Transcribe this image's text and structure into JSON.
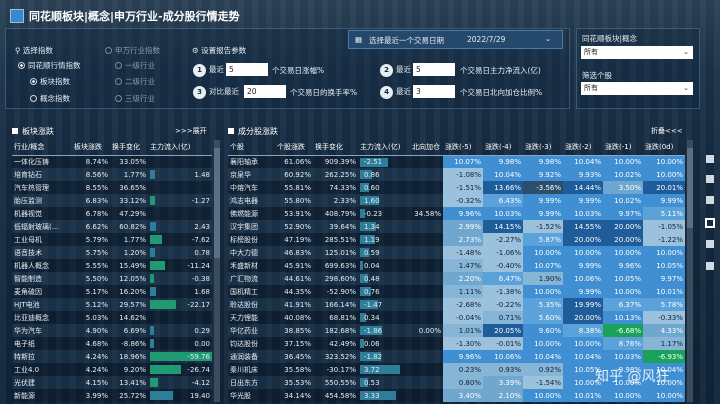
{
  "header": {
    "title": "同花顺板块|概念|申万行业-成分股行情走势"
  },
  "filters": {
    "select_index_label": "选择指数",
    "sw_industry_label": "申万行业指数",
    "ths_index_label": "同花顺行情指数",
    "sector_index": "板块指数",
    "concept_index": "概念指数",
    "level1": "一级行业",
    "level2": "二级行业",
    "level3": "三级行业",
    "settings_label": "设置报告参数",
    "p1_prefix": "最近",
    "p1_value": "5",
    "p1_suffix": "个交易日涨幅%",
    "p2_prefix": "最近",
    "p2_value": "5",
    "p2_suffix": "个交易日主力净流入(亿)",
    "p3_prefix": "对比最近",
    "p3_value": "20",
    "p3_suffix": "个交易日的换手率%",
    "p4_prefix": "最近",
    "p4_value": "3",
    "p4_suffix": "个交易日北向加仓比例%",
    "date_label": "选择最近一个交易日期",
    "date_value": "2022/7/29",
    "concept_select_label": "同花顺板块|概念",
    "concept_select_value": "所有",
    "stock_filter_label": "筛选个股",
    "stock_filter_value": "所有"
  },
  "left": {
    "title": "板块涨跌",
    "expand": ">>>展开",
    "headers": [
      "行业/概念",
      "板块涨跌",
      "换手变化",
      "主力流入(亿)"
    ],
    "rows": [
      [
        "一体化压铸",
        "8.74%",
        "33.05%",
        ""
      ],
      [
        "培育钻石",
        "8.56%",
        "1.77%",
        "1.48"
      ],
      [
        "汽车热管理",
        "8.55%",
        "36.65%",
        ""
      ],
      [
        "胎压监测",
        "6.83%",
        "33.12%",
        "-1.27"
      ],
      [
        "机器视觉",
        "6.78%",
        "47.29%",
        ""
      ],
      [
        "低辐射玻璃(...",
        "6.62%",
        "60.82%",
        "2.43"
      ],
      [
        "工业母机",
        "5.79%",
        "1.77%",
        "-7.62"
      ],
      [
        "语音技术",
        "5.75%",
        "1.20%",
        "0.78"
      ],
      [
        "机器人概念",
        "5.55%",
        "15.49%",
        "-11.24"
      ],
      [
        "智能制造",
        "5.50%",
        "12.05%",
        "-0.38"
      ],
      [
        "麦角硫因",
        "5.17%",
        "16.20%",
        "1.68"
      ],
      [
        "HJT电池",
        "5.12%",
        "29.57%",
        "-22.17"
      ],
      [
        "比亚迪概念",
        "5.03%",
        "14.62%",
        ""
      ],
      [
        "华为汽车",
        "4.90%",
        "6.69%",
        "0.29"
      ],
      [
        "电子纸",
        "4.68%",
        "-8.86%",
        "0.00"
      ],
      [
        "特斯拉",
        "4.24%",
        "18.96%",
        "-59.76"
      ],
      [
        "工业4.0",
        "4.24%",
        "9.20%",
        "-26.74"
      ],
      [
        "光伏建",
        "4.15%",
        "13.41%",
        "-4.12"
      ],
      [
        "新能源",
        "3.99%",
        "25.72%",
        "19.40"
      ]
    ],
    "flow": [
      null,
      1.48,
      null,
      -1.27,
      null,
      2.43,
      -7.62,
      0.78,
      -11.24,
      -0.38,
      1.68,
      -22.17,
      null,
      0.29,
      0,
      -59.76,
      -26.74,
      -4.12,
      19.4
    ]
  },
  "right": {
    "title": "成分股涨跌",
    "collapse": "折叠<<<",
    "headers": [
      "个股",
      "个股涨跌",
      "换手变化",
      "主力流入(亿)",
      "北向加仓",
      "涨跌(-5)",
      "涨跌(-4)",
      "涨跌(-3)",
      "涨跌(-2)",
      "涨跌(-1)",
      "涨跌(0d)"
    ],
    "rows": [
      [
        "襄阳轴承",
        "61.06%",
        "909.39%",
        "-2.51",
        "",
        "10.07%",
        "9.98%",
        "9.98%",
        "10.04%",
        "10.00%",
        "10.00%"
      ],
      [
        "京泉华",
        "60.92%",
        "262.25%",
        "0.86",
        "",
        "-1.08%",
        "10.04%",
        "9.92%",
        "9.93%",
        "10.02%",
        "10.00%"
      ],
      [
        "中熔汽车",
        "55.81%",
        "74.33%",
        "0.60",
        "",
        "-1.51%",
        "13.66%",
        "-3.56%",
        "14.44%",
        "3.50%",
        "20.01%"
      ],
      [
        "鸿志电器",
        "55.80%",
        "2.33%",
        "1.60",
        "",
        "-0.32%",
        "6.43%",
        "9.99%",
        "9.99%",
        "10.02%",
        "9.99%"
      ],
      [
        "佛燃能源",
        "53.91%",
        "408.79%",
        "-0.23",
        "34.58%",
        "9.96%",
        "10.03%",
        "9.99%",
        "10.03%",
        "9.97%",
        "5.11%"
      ],
      [
        "汉宇集团",
        "52.90%",
        "39.64%",
        "1.34",
        "",
        "2.99%",
        "14.15%",
        "-1.52%",
        "14.55%",
        "20.00%",
        "-1.05%"
      ],
      [
        "标榜股份",
        "47.19%",
        "285.51%",
        "1.19",
        "",
        "2.73%",
        "-2.27%",
        "5.87%",
        "20.00%",
        "20.00%",
        "-1.22%"
      ],
      [
        "中大力德",
        "46.83%",
        "125.01%",
        "0.59",
        "",
        "-1.48%",
        "-1.06%",
        "10.00%",
        "10.00%",
        "10.00%",
        "10.00%"
      ],
      [
        "禾盛新材",
        "45.91%",
        "699.63%",
        "0.04",
        "",
        "1.47%",
        "-0.40%",
        "10.07%",
        "9.99%",
        "9.96%",
        "10.05%"
      ],
      [
        "广汇物流",
        "44.61%",
        "298.60%",
        "0.48",
        "",
        "2.20%",
        "6.47%",
        "1.90%",
        "10.06%",
        "10.05%",
        "9.97%"
      ],
      [
        "国机精工",
        "44.35%",
        "-52.90%",
        "0.76",
        "",
        "1.11%",
        "-1.38%",
        "10.00%",
        "9.99%",
        "10.00%",
        "10.01%"
      ],
      [
        "聆达股份",
        "41.91%",
        "166.14%",
        "-1.47",
        "",
        "-2.68%",
        "-0.22%",
        "5.35%",
        "19.99%",
        "6.37%",
        "5.78%"
      ],
      [
        "天力锂能",
        "40.08%",
        "68.81%",
        "0.34",
        "",
        "-0.04%",
        "0.71%",
        "5.60%",
        "20.00%",
        "10.13%",
        "-0.33%"
      ],
      [
        "华亿药业",
        "38.85%",
        "182.68%",
        "-1.86",
        "0.00%",
        "1.01%",
        "20.05%",
        "9.60%",
        "8.38%",
        "-6.68%",
        "4.33%"
      ],
      [
        "钧达股份",
        "37.15%",
        "42.49%",
        "0.06",
        "",
        "-1.30%",
        "-0.01%",
        "10.00%",
        "10.00%",
        "8.76%",
        "1.17%"
      ],
      [
        "通润装备",
        "36.45%",
        "323.52%",
        "-1.82",
        "",
        "9.96%",
        "10.06%",
        "10.04%",
        "10.04%",
        "10.03%",
        "-6.93%"
      ],
      [
        "秦川机床",
        "35.58%",
        "-30.17%",
        "3.72",
        "",
        "0.23%",
        "0.93%",
        "0.92%",
        "10.05%",
        "9.98%",
        "10.04%"
      ],
      [
        "日出东方",
        "35.53%",
        "550.55%",
        "0.53",
        "",
        "0.80%",
        "3.39%",
        "-1.54%",
        "10.00%",
        "10.00%",
        "10.00%"
      ],
      [
        "华光股",
        "34.14%",
        "454.58%",
        "3.33",
        "",
        "3.40%",
        "2.10%",
        "10.00%",
        "10.01%",
        "10.00%",
        "10.00%"
      ]
    ],
    "flow": [
      -2.51,
      0.86,
      0.6,
      1.6,
      -0.23,
      1.34,
      1.19,
      0.59,
      0.04,
      0.48,
      0.76,
      -1.47,
      0.34,
      -1.86,
      0.06,
      -1.82,
      3.72,
      0.53,
      3.33
    ]
  },
  "watermark": "知乎 @风狂"
}
